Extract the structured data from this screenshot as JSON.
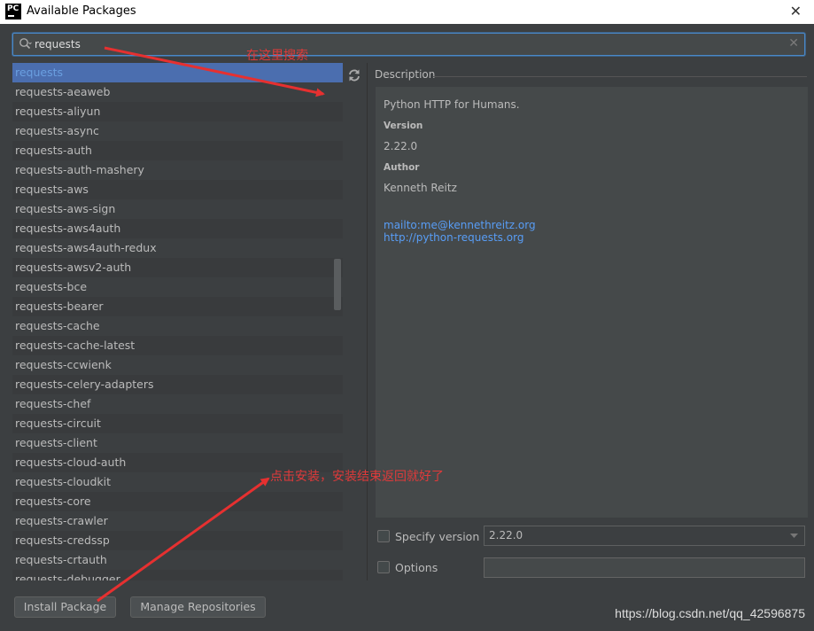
{
  "window": {
    "title": "Available Packages",
    "logo_text": "PC"
  },
  "search": {
    "value": "requests",
    "placeholder": ""
  },
  "packages": {
    "selected": "requests",
    "items": [
      "requests",
      "requests-aeaweb",
      "requests-aliyun",
      "requests-async",
      "requests-auth",
      "requests-auth-mashery",
      "requests-aws",
      "requests-aws-sign",
      "requests-aws4auth",
      "requests-aws4auth-redux",
      "requests-awsv2-auth",
      "requests-bce",
      "requests-bearer",
      "requests-cache",
      "requests-cache-latest",
      "requests-ccwienk",
      "requests-celery-adapters",
      "requests-chef",
      "requests-circuit",
      "requests-client",
      "requests-cloud-auth",
      "requests-cloudkit",
      "requests-core",
      "requests-crawler",
      "requests-credssp",
      "requests-crtauth",
      "requests-debugger"
    ]
  },
  "description": {
    "header": "Description",
    "summary": "Python HTTP for Humans.",
    "version_label": "Version",
    "version": "2.22.0",
    "author_label": "Author",
    "author": "Kenneth Reitz",
    "email_link": "mailto:me@kennethreitz.org",
    "home_link": "http://python-requests.org"
  },
  "options": {
    "specify_version_label": "Specify version",
    "specify_version_value": "2.22.0",
    "options_label": "Options",
    "options_value": ""
  },
  "buttons": {
    "install": "Install Package",
    "manage": "Manage Repositories"
  },
  "annotations": {
    "search_hint": "在这里搜索",
    "install_hint": "点击安装，安装结束返回就好了",
    "color": "#e03a3a"
  },
  "watermark": "https://blog.csdn.net/qq_42596875",
  "colors": {
    "background": "#3c3f41",
    "selection": "#4b6eaf",
    "link": "#589df6"
  }
}
